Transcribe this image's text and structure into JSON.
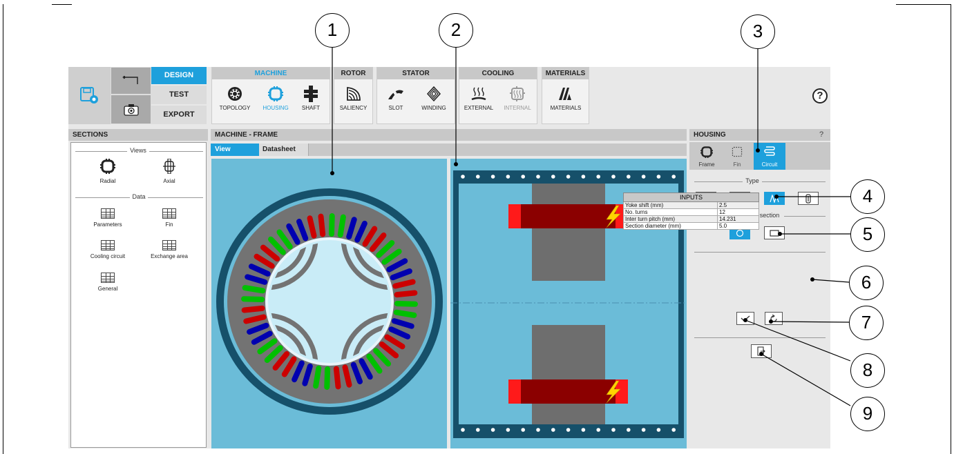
{
  "nav": {
    "design": "DESIGN",
    "test": "TEST",
    "export": "EXPORT"
  },
  "groups": {
    "machine": {
      "title": "MACHINE",
      "tools": [
        "TOPOLOGY",
        "HOUSING",
        "SHAFT"
      ]
    },
    "rotor": {
      "title": "ROTOR",
      "tools": [
        "SALIENCY"
      ]
    },
    "stator": {
      "title": "STATOR",
      "tools": [
        "SLOT",
        "WINDING"
      ]
    },
    "cooling": {
      "title": "COOLING",
      "tools": [
        "EXTERNAL",
        "INTERNAL"
      ]
    },
    "materials": {
      "title": "MATERIALS",
      "tools": [
        "MATERIALS"
      ]
    }
  },
  "help_glyph": "?",
  "sections": {
    "title": "SECTIONS",
    "views_title": "Views",
    "views": [
      "Radial",
      "Axial"
    ],
    "data_title": "Data",
    "data": [
      "Parameters",
      "Fin",
      "Cooling circuit",
      "Exchange area",
      "General"
    ]
  },
  "center": {
    "title": "MACHINE - FRAME",
    "tabs": [
      "View",
      "Datasheet"
    ]
  },
  "housing": {
    "title": "HOUSING",
    "help": "?",
    "tabs": [
      "Frame",
      "Fin",
      "Circuit"
    ],
    "type_title": "Type",
    "circuit_section_title": "Circuit section",
    "inputs_title": "INPUTS",
    "inputs": [
      {
        "label": "Yoke shift (mm)",
        "value": "2.5"
      },
      {
        "label": "No. turns",
        "value": "12"
      },
      {
        "label": "Inter turn pitch (mm)",
        "value": "14.231"
      },
      {
        "label": "Section diameter (mm)",
        "value": "5.0"
      }
    ]
  },
  "callouts": [
    "1",
    "2",
    "3",
    "4",
    "5",
    "6",
    "7",
    "8",
    "9"
  ],
  "colors": {
    "accent": "#1ea0dc",
    "view_bg": "#6bbcd8",
    "frame_dark": "#16506a",
    "coil": "#8b0000"
  }
}
